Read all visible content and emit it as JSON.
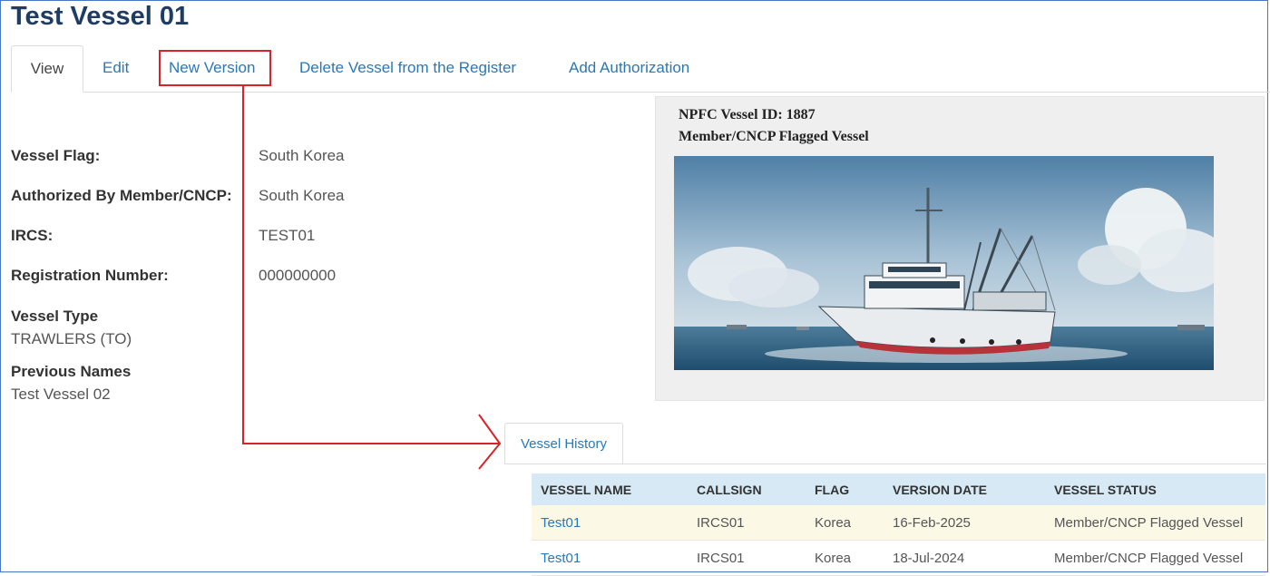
{
  "page": {
    "title": "Test Vessel 01"
  },
  "tabs": [
    {
      "label": "View"
    },
    {
      "label": "Edit"
    },
    {
      "label": "New Version"
    },
    {
      "label": "Delete Vessel from the Register"
    },
    {
      "label": "Add Authorization"
    }
  ],
  "details": {
    "flag_label": "Vessel Flag:",
    "flag_value": "South Korea",
    "authorized_label": "Authorized By Member/CNCP:",
    "authorized_value": "South Korea",
    "ircs_label": "IRCS:",
    "ircs_value": "TEST01",
    "reg_label": "Registration Number:",
    "reg_value": "000000000",
    "type_label": "Vessel Type",
    "type_value": "TRAWLERS (TO)",
    "prev_label": "Previous Names",
    "prev_value": "Test Vessel 02"
  },
  "panel": {
    "vessel_id": "NPFC Vessel ID: 1887",
    "status": "Member/CNCP Flagged Vessel"
  },
  "history": {
    "tab_label": "Vessel History",
    "headers": [
      "VESSEL NAME",
      "CALLSIGN",
      "FLAG",
      "VERSION DATE",
      "VESSEL STATUS"
    ],
    "rows": [
      [
        "Test01",
        "IRCS01",
        "Korea",
        "16-Feb-2025",
        "Member/CNCP Flagged Vessel"
      ],
      [
        "Test01",
        "IRCS01",
        "Korea",
        "18-Jul-2024",
        "Member/CNCP Flagged Vessel"
      ]
    ]
  },
  "colors": {
    "accent_link": "#2a78b5",
    "title": "#1f3c63",
    "annotation_red": "#d8232a",
    "table_header": "#d6e9f5"
  }
}
